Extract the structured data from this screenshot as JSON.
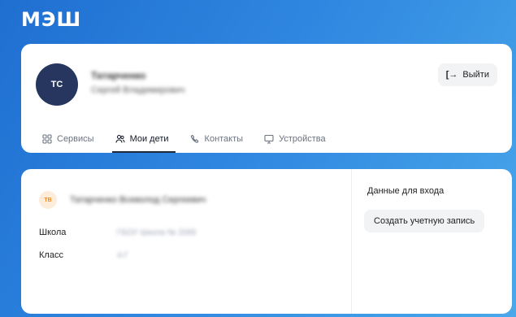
{
  "app": {
    "logo": "МЭШ"
  },
  "profile": {
    "initials": "ТС",
    "last_name": "Татарченко",
    "first_middle": "Сергей Владимирович",
    "logout_label": "Выйти"
  },
  "tabs": [
    {
      "label": "Сервисы",
      "icon": "grid-icon"
    },
    {
      "label": "Мои дети",
      "icon": "people-icon",
      "active": true
    },
    {
      "label": "Контакты",
      "icon": "phone-icon"
    },
    {
      "label": "Устройства",
      "icon": "monitor-icon"
    }
  ],
  "child": {
    "initials": "ТВ",
    "full_name": "Татарченко Всеволод Сергеевич",
    "school_label": "Школа",
    "school_value": "ГБОУ Школа № 2065",
    "class_label": "Класс",
    "class_value": "4-Г"
  },
  "login": {
    "title": "Данные для входа",
    "create_label": "Создать учетную запись"
  },
  "colors": {
    "background": "#2f86e0",
    "avatar": "#26365e",
    "child_badge_bg": "#fdecd9",
    "child_badge_fg": "#f08a24"
  }
}
